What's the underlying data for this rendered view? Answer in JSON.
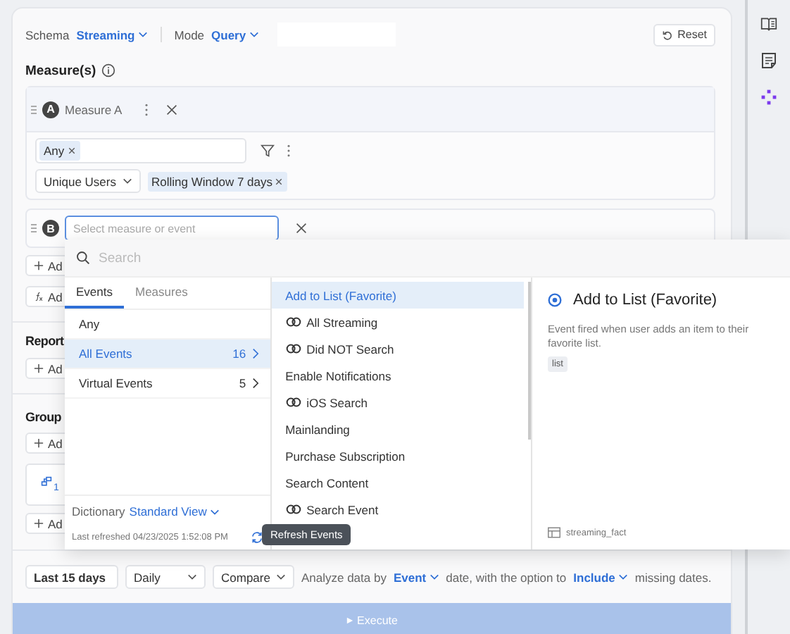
{
  "header": {
    "schema_label": "Schema",
    "schema_value": "Streaming",
    "mode_label": "Mode",
    "mode_value": "Query",
    "reset": "Reset"
  },
  "measures": {
    "title": "Measure(s)",
    "measure_a": {
      "letter": "A",
      "name": "Measure A",
      "filter_chip": "Any",
      "aggregation": "Unique Users",
      "window_chip": "Rolling Window 7 days"
    },
    "measure_b": {
      "letter": "B",
      "placeholder": "Select measure or event"
    },
    "actions": [
      {
        "kind": "add",
        "label": "Ad"
      },
      {
        "kind": "formula",
        "label": "Ad"
      }
    ]
  },
  "report": {
    "title": "Report",
    "add": "Ad"
  },
  "group": {
    "title": "Group",
    "add": "Ad",
    "card_index": "1",
    "add_second": "Ad"
  },
  "popup": {
    "search_placeholder": "Search",
    "tabs": [
      {
        "label": "Events",
        "selected": true
      },
      {
        "label": "Measures",
        "selected": false
      }
    ],
    "categories": [
      {
        "label": "Any",
        "selected": false
      },
      {
        "label": "All Events",
        "count": "16",
        "selected": true
      },
      {
        "label": "Virtual Events",
        "count": "5",
        "selected": false
      }
    ],
    "dictionary_label": "Dictionary",
    "dictionary_value": "Standard View",
    "last_refreshed": "Last refreshed 04/23/2025 1:52:08 PM",
    "tooltip": "Refresh Events",
    "events": [
      {
        "label": "Add to List (Favorite)",
        "kind": "plain",
        "selected": true
      },
      {
        "label": "All Streaming",
        "kind": "virtual",
        "selected": false
      },
      {
        "label": "Did NOT Search",
        "kind": "virtual",
        "selected": false
      },
      {
        "label": "Enable Notifications",
        "kind": "plain",
        "selected": false
      },
      {
        "label": "iOS Search",
        "kind": "virtual",
        "selected": false
      },
      {
        "label": "Mainlanding",
        "kind": "plain",
        "selected": false
      },
      {
        "label": "Purchase Subscription",
        "kind": "plain",
        "selected": false
      },
      {
        "label": "Search Content",
        "kind": "plain",
        "selected": false
      },
      {
        "label": "Search Event",
        "kind": "virtual",
        "selected": false
      }
    ],
    "detail": {
      "title": "Add to List (Favorite)",
      "description": "Event fired when user adds an item to their favorite list.",
      "tag": "list",
      "table": "streaming_fact"
    }
  },
  "footer": {
    "range": "Last 15 days",
    "interval": "Daily",
    "compare": "Compare",
    "text_1": "Analyze data by",
    "date_option": "Event",
    "text_2": "date, with the option to",
    "missing_option": "Include",
    "text_3": "missing dates.",
    "execute": "Execute",
    "execute_disabled": true
  }
}
